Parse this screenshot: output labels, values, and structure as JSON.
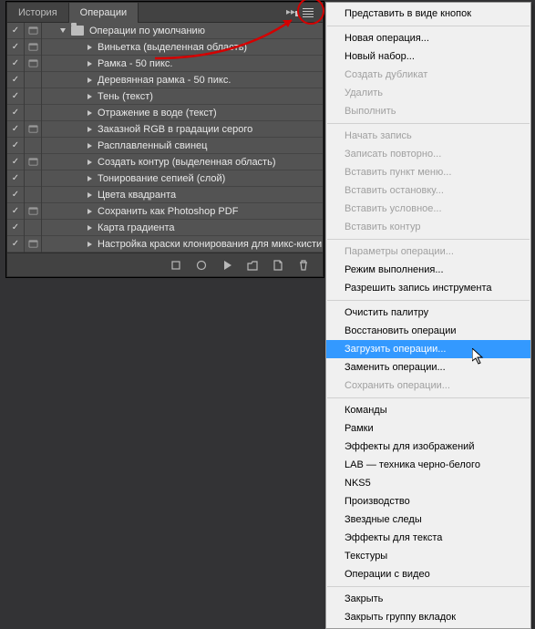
{
  "tabs": {
    "history": "История",
    "operations": "Операции"
  },
  "action_set": {
    "name": "Операции по умолчанию"
  },
  "actions": [
    {
      "label": "Виньетка (выделенная область)",
      "toggle": true
    },
    {
      "label": "Рамка - 50 пикс.",
      "toggle": true
    },
    {
      "label": "Деревянная рамка - 50 пикс.",
      "toggle": false
    },
    {
      "label": "Тень (текст)",
      "toggle": false
    },
    {
      "label": "Отражение в воде (текст)",
      "toggle": false
    },
    {
      "label": "Заказной RGB в градации серого",
      "toggle": true
    },
    {
      "label": "Расплавленный свинец",
      "toggle": false
    },
    {
      "label": "Создать контур (выделенная область)",
      "toggle": true
    },
    {
      "label": "Тонирование сепией (слой)",
      "toggle": false
    },
    {
      "label": "Цвета квадранта",
      "toggle": false
    },
    {
      "label": "Сохранить как Photoshop PDF",
      "toggle": true
    },
    {
      "label": "Карта градиента",
      "toggle": false
    },
    {
      "label": "Настройка краски клонирования для микс-кисти",
      "toggle": true
    }
  ],
  "menu": [
    {
      "type": "item",
      "label": "Представить в виде кнопок"
    },
    {
      "type": "sep"
    },
    {
      "type": "item",
      "label": "Новая операция..."
    },
    {
      "type": "item",
      "label": "Новый набор..."
    },
    {
      "type": "item",
      "label": "Создать дубликат",
      "disabled": true
    },
    {
      "type": "item",
      "label": "Удалить",
      "disabled": true
    },
    {
      "type": "item",
      "label": "Выполнить",
      "disabled": true
    },
    {
      "type": "sep"
    },
    {
      "type": "item",
      "label": "Начать запись",
      "disabled": true
    },
    {
      "type": "item",
      "label": "Записать повторно...",
      "disabled": true
    },
    {
      "type": "item",
      "label": "Вставить пункт меню...",
      "disabled": true
    },
    {
      "type": "item",
      "label": "Вставить остановку...",
      "disabled": true
    },
    {
      "type": "item",
      "label": "Вставить условное...",
      "disabled": true
    },
    {
      "type": "item",
      "label": "Вставить контур",
      "disabled": true
    },
    {
      "type": "sep"
    },
    {
      "type": "item",
      "label": "Параметры операции...",
      "disabled": true
    },
    {
      "type": "item",
      "label": "Режим выполнения..."
    },
    {
      "type": "item",
      "label": "Разрешить запись инструмента"
    },
    {
      "type": "sep"
    },
    {
      "type": "item",
      "label": "Очистить палитру"
    },
    {
      "type": "item",
      "label": "Восстановить операции"
    },
    {
      "type": "item",
      "label": "Загрузить операции...",
      "hover": true
    },
    {
      "type": "item",
      "label": "Заменить операции..."
    },
    {
      "type": "item",
      "label": "Сохранить операции...",
      "disabled": true
    },
    {
      "type": "sep"
    },
    {
      "type": "item",
      "label": "Команды"
    },
    {
      "type": "item",
      "label": "Рамки"
    },
    {
      "type": "item",
      "label": "Эффекты для изображений"
    },
    {
      "type": "item",
      "label": "LAB — техника черно-белого"
    },
    {
      "type": "item",
      "label": "NKS5"
    },
    {
      "type": "item",
      "label": "Производство"
    },
    {
      "type": "item",
      "label": "Звездные следы"
    },
    {
      "type": "item",
      "label": "Эффекты для текста"
    },
    {
      "type": "item",
      "label": "Текстуры"
    },
    {
      "type": "item",
      "label": "Операции с видео"
    },
    {
      "type": "sep"
    },
    {
      "type": "item",
      "label": "Закрыть"
    },
    {
      "type": "item",
      "label": "Закрыть группу вкладок"
    }
  ]
}
